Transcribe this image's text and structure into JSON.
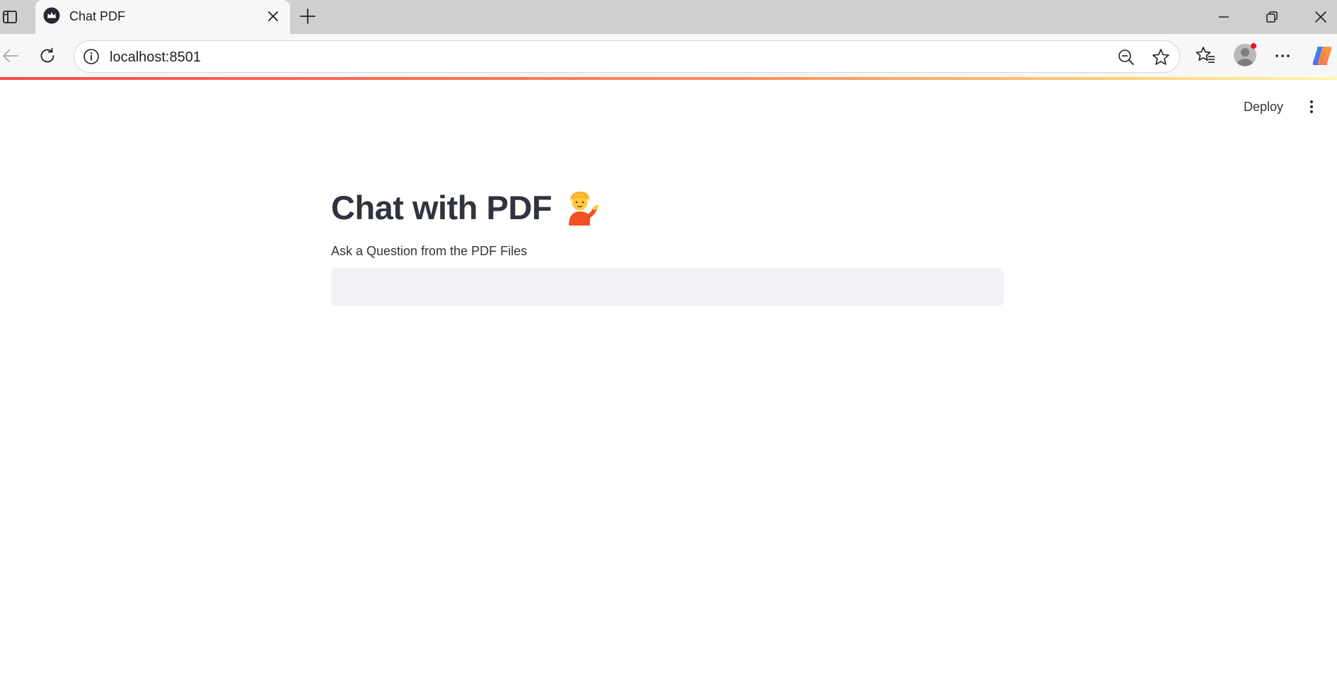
{
  "browser": {
    "tab": {
      "title": "Chat PDF",
      "favicon": "crown-icon"
    },
    "address_bar": {
      "url": "localhost:8501"
    },
    "icons": {
      "sidebar_toggle": "sidebar-icon",
      "tab_close": "close-icon",
      "new_tab": "plus-icon",
      "minimize": "minimize-icon",
      "restore": "restore-icon",
      "window_close": "close-icon",
      "back": "arrow-left-icon",
      "reload": "reload-icon",
      "site_info": "info-icon",
      "zoom": "zoom-out-icon",
      "add_favorite": "star-icon",
      "favorites": "favorites-icon",
      "profile": "avatar-icon",
      "more": "more-horizontal-icon",
      "copilot": "copilot-icon"
    }
  },
  "app": {
    "header": {
      "deploy_label": "Deploy",
      "menu_icon": "more-vertical-icon"
    },
    "main": {
      "title": "Chat with PDF",
      "title_emoji": "person-tipping-hand-emoji",
      "question_label": "Ask a Question from the PDF Files",
      "question_value": ""
    }
  },
  "colors": {
    "accent_gradient_start": "#ff4b4b",
    "accent_gradient_end": "#fff7b0",
    "text": "#31333f",
    "input_background": "#f0f2f6",
    "tabstrip_background": "#cfcfcf",
    "toolbar_background": "#f7f7f7"
  }
}
